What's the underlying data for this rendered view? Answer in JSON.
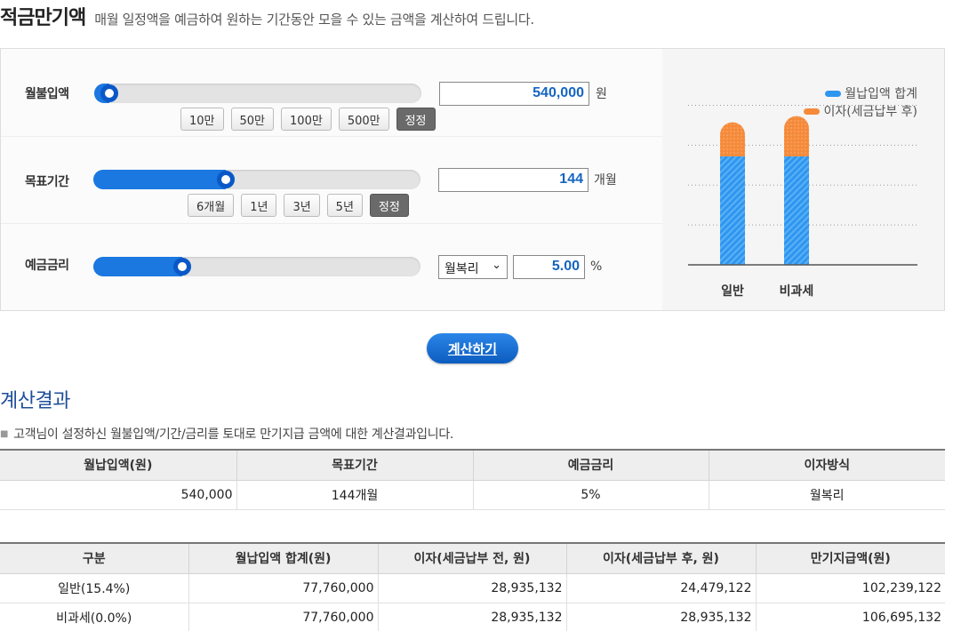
{
  "header": {
    "title": "적금만기액",
    "desc": "매월 일정액을 예금하여 원하는 기간동안 모을 수 있는 금액을 계산하여 드립니다."
  },
  "inputs": {
    "monthly": {
      "label": "월불입액",
      "value": "540,000",
      "unit": "원",
      "slider_level": 0.02,
      "buttons": [
        "10만",
        "50만",
        "100만",
        "500만"
      ],
      "reset": "정정"
    },
    "period": {
      "label": "목표기간",
      "value": "144",
      "unit": "개월",
      "slider_level": 0.4,
      "buttons": [
        "6개월",
        "1년",
        "3년",
        "5년"
      ],
      "reset": "정정"
    },
    "rate": {
      "label": "예금금리",
      "method": "월복리",
      "value": "5.00",
      "unit": "%",
      "slider_level": 0.26
    }
  },
  "chart_data": {
    "type": "bar",
    "stacked": true,
    "categories": [
      "일반",
      "비과세"
    ],
    "series": [
      {
        "name": "월납입액 합계",
        "color": "#2f96f0",
        "values": [
          77760000,
          77760000
        ]
      },
      {
        "name": "이자(세금납부 후)",
        "color": "#f58a3a",
        "values": [
          24479122,
          28935132
        ]
      }
    ],
    "ylim": [
      0,
      130000000
    ],
    "legend": "top-right",
    "grid": true
  },
  "calc_button": "계산하기",
  "result": {
    "title": "계산결과",
    "desc": "고객님이 설정하신 월불입액/기간/금리를 토대로 만기지급 금액에 대한 계산결과입니다.",
    "table1": {
      "headers": [
        "월납입액(원)",
        "목표기간",
        "예금금리",
        "이자방식"
      ],
      "row": [
        "540,000",
        "144개월",
        "5%",
        "월복리"
      ]
    },
    "table2": {
      "headers": [
        "구분",
        "월납입액 합계(원)",
        "이자(세금납부 전, 원)",
        "이자(세금납부 후, 원)",
        "만기지급액(원)"
      ],
      "rows": [
        [
          "일반(15.4%)",
          "77,760,000",
          "28,935,132",
          "24,479,122",
          "102,239,122"
        ],
        [
          "비과세(0.0%)",
          "77,760,000",
          "28,935,132",
          "28,935,132",
          "106,695,132"
        ]
      ]
    }
  }
}
